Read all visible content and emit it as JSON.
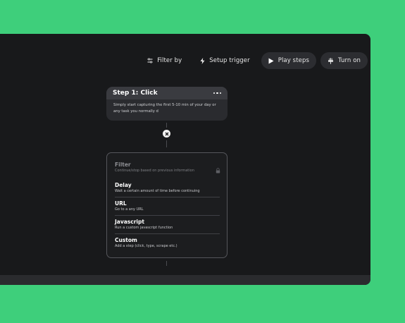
{
  "toolbar": {
    "filter_label": "Filter by",
    "setup_trigger_label": "Setup trigger",
    "play_steps_label": "Play steps",
    "turn_on_label": "Turn on"
  },
  "step": {
    "title": "Step 1: Click",
    "description": "Simply start capturing the first 5-10 min of your day or any task you normally d"
  },
  "menu": {
    "items": [
      {
        "title": "Filter",
        "subtitle": "Continue/stop based on previous information",
        "locked": true
      },
      {
        "title": "Delay",
        "subtitle": "Wait a certain amount of time before continuing"
      },
      {
        "title": "URL",
        "subtitle": "Go to a any URL"
      },
      {
        "title": "Javascript",
        "subtitle": "Run a custom javascript function"
      },
      {
        "title": "Custom",
        "subtitle": "Add a step (click, type, scrape etc.)"
      }
    ]
  },
  "icons": [
    "filter-icon",
    "lightning-icon",
    "play-icon",
    "plug-icon",
    "more-icon",
    "close-icon",
    "lock-icon"
  ],
  "colors": {
    "background": "#3ecf7b",
    "window": "#18191b",
    "card": "#2a2b2f"
  }
}
